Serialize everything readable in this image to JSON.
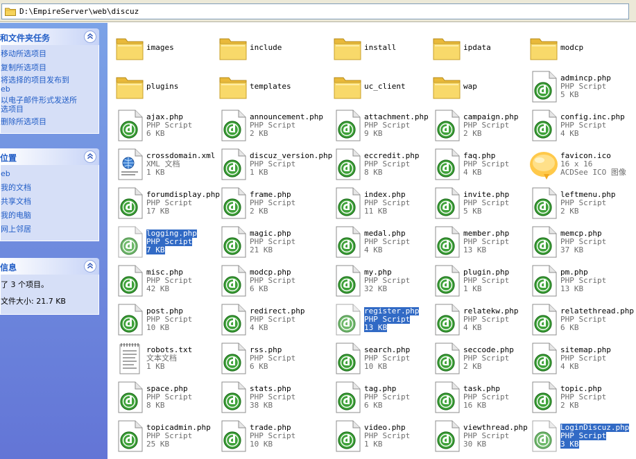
{
  "address": {
    "path": "D:\\EmpireServer\\web\\discuz"
  },
  "taskpane": {
    "file_tasks": {
      "title": "和文件夹任务",
      "items": [
        "移动所选项目",
        "复制所选项目",
        "将选择的项目发布到",
        "eb",
        "以电子邮件形式发送所",
        "选项目",
        "删除所选项目"
      ]
    },
    "places": {
      "title": "位置",
      "items": [
        "eb",
        "我的文档",
        "共享文档",
        "我的电脑",
        "网上邻居"
      ]
    },
    "details": {
      "title": "信息",
      "lines": [
        "了 3 个项目。",
        "文件大小: 21.7 KB"
      ]
    }
  },
  "columns_x": [
    4,
    153,
    318,
    461,
    601
  ],
  "rows_y": [
    8,
    64,
    120,
    176,
    232,
    288,
    344,
    400,
    456,
    512,
    568
  ],
  "files": [
    {
      "name": "images",
      "type": "",
      "size": "",
      "kind": "folder",
      "col": 0,
      "row": 0
    },
    {
      "name": "include",
      "type": "",
      "size": "",
      "kind": "folder",
      "col": 1,
      "row": 0
    },
    {
      "name": "install",
      "type": "",
      "size": "",
      "kind": "folder",
      "col": 2,
      "row": 0
    },
    {
      "name": "ipdata",
      "type": "",
      "size": "",
      "kind": "folder",
      "col": 3,
      "row": 0
    },
    {
      "name": "modcp",
      "type": "",
      "size": "",
      "kind": "folder",
      "col": 4,
      "row": 0
    },
    {
      "name": "plugins",
      "type": "",
      "size": "",
      "kind": "folder",
      "col": 0,
      "row": 1
    },
    {
      "name": "templates",
      "type": "",
      "size": "",
      "kind": "folder",
      "col": 1,
      "row": 1
    },
    {
      "name": "uc_client",
      "type": "",
      "size": "",
      "kind": "folder",
      "col": 2,
      "row": 1
    },
    {
      "name": "wap",
      "type": "",
      "size": "",
      "kind": "folder",
      "col": 3,
      "row": 1
    },
    {
      "name": "admincp.php",
      "type": "PHP Script",
      "size": "5 KB",
      "kind": "php",
      "col": 4,
      "row": 1
    },
    {
      "name": "ajax.php",
      "type": "PHP Script",
      "size": "6 KB",
      "kind": "php",
      "col": 0,
      "row": 2
    },
    {
      "name": "announcement.php",
      "type": "PHP Script",
      "size": "2 KB",
      "kind": "php",
      "col": 1,
      "row": 2
    },
    {
      "name": "attachment.php",
      "type": "PHP Script",
      "size": "9 KB",
      "kind": "php",
      "col": 2,
      "row": 2
    },
    {
      "name": "campaign.php",
      "type": "PHP Script",
      "size": "2 KB",
      "kind": "php",
      "col": 3,
      "row": 2
    },
    {
      "name": "config.inc.php",
      "type": "PHP Script",
      "size": "4 KB",
      "kind": "php",
      "col": 4,
      "row": 2
    },
    {
      "name": "crossdomain.xml",
      "type": "XML 文档",
      "size": "1 KB",
      "kind": "xml",
      "col": 0,
      "row": 3
    },
    {
      "name": "discuz_version.php",
      "type": "PHP Script",
      "size": "1 KB",
      "kind": "php",
      "col": 1,
      "row": 3
    },
    {
      "name": "eccredit.php",
      "type": "PHP Script",
      "size": "8 KB",
      "kind": "php",
      "col": 2,
      "row": 3
    },
    {
      "name": "faq.php",
      "type": "PHP Script",
      "size": "4 KB",
      "kind": "php",
      "col": 3,
      "row": 3
    },
    {
      "name": "favicon.ico",
      "type": "16 x 16",
      "size": "ACDSee ICO 图像",
      "kind": "ico",
      "col": 4,
      "row": 3
    },
    {
      "name": "forumdisplay.php",
      "type": "PHP Script",
      "size": "17 KB",
      "kind": "php",
      "col": 0,
      "row": 4
    },
    {
      "name": "frame.php",
      "type": "PHP Script",
      "size": "2 KB",
      "kind": "php",
      "col": 1,
      "row": 4
    },
    {
      "name": "index.php",
      "type": "PHP Script",
      "size": "11 KB",
      "kind": "php",
      "col": 2,
      "row": 4
    },
    {
      "name": "invite.php",
      "type": "PHP Script",
      "size": "5 KB",
      "kind": "php",
      "col": 3,
      "row": 4
    },
    {
      "name": "leftmenu.php",
      "type": "PHP Script",
      "size": "2 KB",
      "kind": "php",
      "col": 4,
      "row": 4
    },
    {
      "name": "logging.php",
      "type": "PHP Script",
      "size": "7 KB",
      "kind": "php",
      "col": 0,
      "row": 5,
      "selected": true
    },
    {
      "name": "magic.php",
      "type": "PHP Script",
      "size": "21 KB",
      "kind": "php",
      "col": 1,
      "row": 5
    },
    {
      "name": "medal.php",
      "type": "PHP Script",
      "size": "4 KB",
      "kind": "php",
      "col": 2,
      "row": 5
    },
    {
      "name": "member.php",
      "type": "PHP Script",
      "size": "13 KB",
      "kind": "php",
      "col": 3,
      "row": 5
    },
    {
      "name": "memcp.php",
      "type": "PHP Script",
      "size": "37 KB",
      "kind": "php",
      "col": 4,
      "row": 5
    },
    {
      "name": "misc.php",
      "type": "PHP Script",
      "size": "42 KB",
      "kind": "php",
      "col": 0,
      "row": 6
    },
    {
      "name": "modcp.php",
      "type": "PHP Script",
      "size": "6 KB",
      "kind": "php",
      "col": 1,
      "row": 6
    },
    {
      "name": "my.php",
      "type": "PHP Script",
      "size": "32 KB",
      "kind": "php",
      "col": 2,
      "row": 6
    },
    {
      "name": "plugin.php",
      "type": "PHP Script",
      "size": "1 KB",
      "kind": "php",
      "col": 3,
      "row": 6
    },
    {
      "name": "pm.php",
      "type": "PHP Script",
      "size": "13 KB",
      "kind": "php",
      "col": 4,
      "row": 6
    },
    {
      "name": "post.php",
      "type": "PHP Script",
      "size": "10 KB",
      "kind": "php",
      "col": 0,
      "row": 7
    },
    {
      "name": "redirect.php",
      "type": "PHP Script",
      "size": "4 KB",
      "kind": "php",
      "col": 1,
      "row": 7
    },
    {
      "name": "register.php",
      "type": "PHP Script",
      "size": "13 KB",
      "kind": "php",
      "col": 2,
      "row": 7,
      "selected": true
    },
    {
      "name": "relatekw.php",
      "type": "PHP Script",
      "size": "4 KB",
      "kind": "php",
      "col": 3,
      "row": 7
    },
    {
      "name": "relatethread.php",
      "type": "PHP Script",
      "size": "6 KB",
      "kind": "php",
      "col": 4,
      "row": 7
    },
    {
      "name": "robots.txt",
      "type": "文本文档",
      "size": "1 KB",
      "kind": "txt",
      "col": 0,
      "row": 8
    },
    {
      "name": "rss.php",
      "type": "PHP Script",
      "size": "6 KB",
      "kind": "php",
      "col": 1,
      "row": 8
    },
    {
      "name": "search.php",
      "type": "PHP Script",
      "size": "10 KB",
      "kind": "php",
      "col": 2,
      "row": 8
    },
    {
      "name": "seccode.php",
      "type": "PHP Script",
      "size": "2 KB",
      "kind": "php",
      "col": 3,
      "row": 8
    },
    {
      "name": "sitemap.php",
      "type": "PHP Script",
      "size": "4 KB",
      "kind": "php",
      "col": 4,
      "row": 8
    },
    {
      "name": "space.php",
      "type": "PHP Script",
      "size": "8 KB",
      "kind": "php",
      "col": 0,
      "row": 9
    },
    {
      "name": "stats.php",
      "type": "PHP Script",
      "size": "38 KB",
      "kind": "php",
      "col": 1,
      "row": 9
    },
    {
      "name": "tag.php",
      "type": "PHP Script",
      "size": "6 KB",
      "kind": "php",
      "col": 2,
      "row": 9
    },
    {
      "name": "task.php",
      "type": "PHP Script",
      "size": "16 KB",
      "kind": "php",
      "col": 3,
      "row": 9
    },
    {
      "name": "topic.php",
      "type": "PHP Script",
      "size": "2 KB",
      "kind": "php",
      "col": 4,
      "row": 9
    },
    {
      "name": "topicadmin.php",
      "type": "PHP Script",
      "size": "25 KB",
      "kind": "php",
      "col": 0,
      "row": 10
    },
    {
      "name": "trade.php",
      "type": "PHP Script",
      "size": "10 KB",
      "kind": "php",
      "col": 1,
      "row": 10
    },
    {
      "name": "video.php",
      "type": "PHP Script",
      "size": "1 KB",
      "kind": "php",
      "col": 2,
      "row": 10
    },
    {
      "name": "viewthread.php",
      "type": "PHP Script",
      "size": "30 KB",
      "kind": "php",
      "col": 3,
      "row": 10
    },
    {
      "name": "LoginDiscuz.php",
      "type": "PHP Script",
      "size": "3 KB",
      "kind": "php",
      "col": 4,
      "row": 10,
      "selected": true
    }
  ],
  "colors": {
    "selection": "#316ac5",
    "taskpane_top": "#7ba2e7",
    "taskpane_bottom": "#6375d6",
    "link": "#215dc6",
    "php_green": "#3fa23a",
    "folder_yellow": "#f6d35b"
  },
  "icons": {
    "folder": "folder-icon",
    "php": "dreamweaver-php-icon",
    "xml": "xml-document-icon",
    "txt": "text-document-icon",
    "ico": "favicon-image-icon",
    "address": "address-folder-icon",
    "collapse": "collapse-chevron-icon"
  }
}
